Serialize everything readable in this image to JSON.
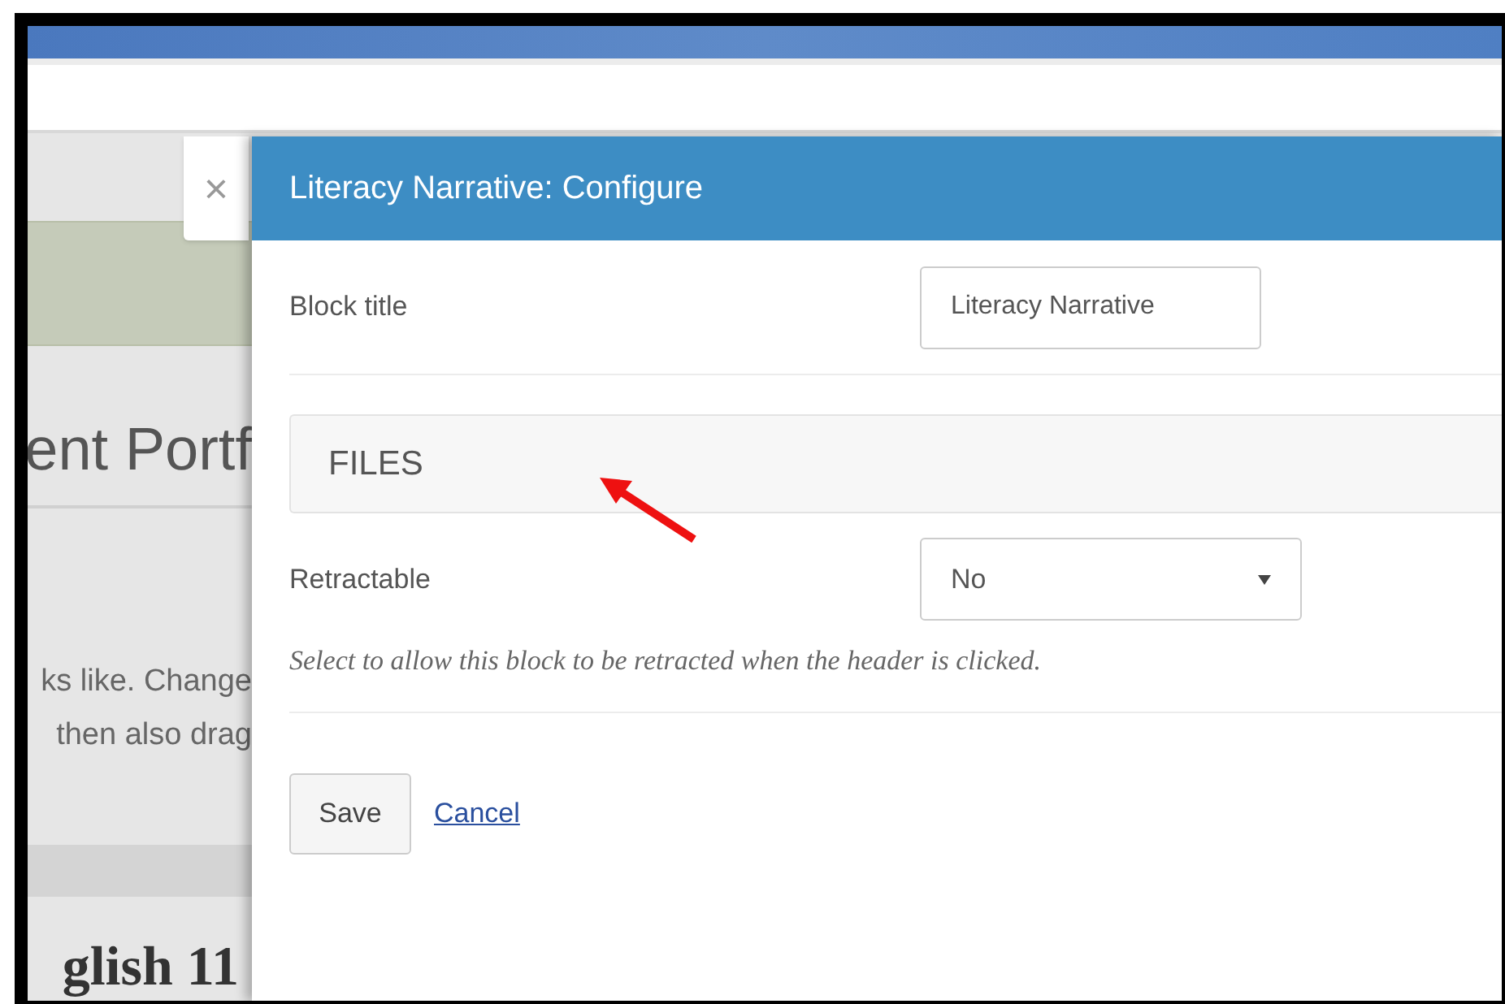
{
  "background_page": {
    "heading_fragment": "ent Portf",
    "text_fragments": [
      "ks like. Change",
      "then also drag"
    ],
    "course_title_fragment": "glish 11"
  },
  "close_tab": {
    "label": "×"
  },
  "dialog": {
    "title": "Literacy Narrative: Configure",
    "fields": [
      {
        "kind": "text",
        "label": "Block title",
        "value": "Literacy Narrative"
      },
      {
        "kind": "panel",
        "label": "FILES"
      },
      {
        "kind": "select",
        "label": "Retractable",
        "value": "No",
        "help": "Select to allow this block to be retracted when the header is clicked."
      }
    ],
    "buttons": [
      {
        "kind": "button",
        "label": "Save"
      },
      {
        "kind": "link",
        "label": "Cancel"
      }
    ]
  }
}
